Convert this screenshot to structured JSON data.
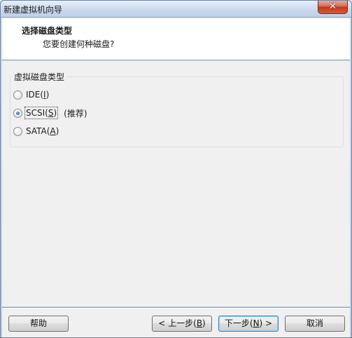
{
  "window": {
    "title": "新建虚拟机向导",
    "close_glyph": "✕"
  },
  "header": {
    "title": "选择磁盘类型",
    "subtitle": "您要创建何种磁盘?"
  },
  "group": {
    "label": "虚拟磁盘类型",
    "options": [
      {
        "text": "IDE(",
        "accel": "I",
        "close": ")",
        "checked": false
      },
      {
        "text": "SCSI(",
        "accel": "S",
        "close": ")",
        "checked": true,
        "note": "(推荐)"
      },
      {
        "text": "SATA(",
        "accel": "A",
        "close": ")",
        "checked": false
      }
    ]
  },
  "buttons": {
    "help": "帮助",
    "back": {
      "prefix": "< 上一步(",
      "accel": "B",
      "suffix": ")"
    },
    "next": {
      "prefix": "下一步(",
      "accel": "N",
      "suffix": ") >"
    },
    "cancel": "取消"
  }
}
